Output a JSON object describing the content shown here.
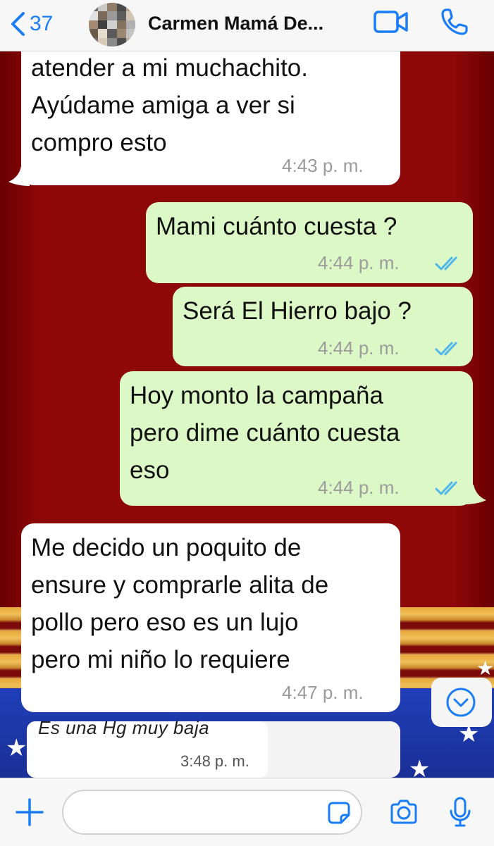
{
  "header": {
    "back_count": "37",
    "contact_name": "Carmen Mamá De..."
  },
  "messages": [
    {
      "dir": "in",
      "text": "atender a mi muchachito.\nAyúdame amiga a ver si\ncompro esto",
      "time": "4:43 p. m."
    },
    {
      "dir": "out",
      "text": "Mami cuánto cuesta ?",
      "time": "4:44 p. m.",
      "status": "read"
    },
    {
      "dir": "out",
      "text": "Será El Hierro bajo ?",
      "time": "4:44 p. m.",
      "status": "read"
    },
    {
      "dir": "out",
      "text": "Hoy monto la campaña\npero dime cuánto cuesta\neso",
      "time": "4:44 p. m.",
      "status": "read"
    },
    {
      "dir": "in",
      "text": "Me decido un poquito de\nensure y comprarle alita de\npollo pero eso es un lujo\npero mi niño lo requiere",
      "time": "4:47 p. m."
    }
  ],
  "quoted": {
    "text": "Es una Hg muy baja",
    "time": "3:48 p. m."
  },
  "input": {
    "placeholder": ""
  },
  "colors": {
    "accent": "#1a7df5",
    "outgoing_bubble": "#dcf8c6",
    "incoming_bubble": "#ffffff",
    "read_ticks": "#4fb6ec"
  }
}
